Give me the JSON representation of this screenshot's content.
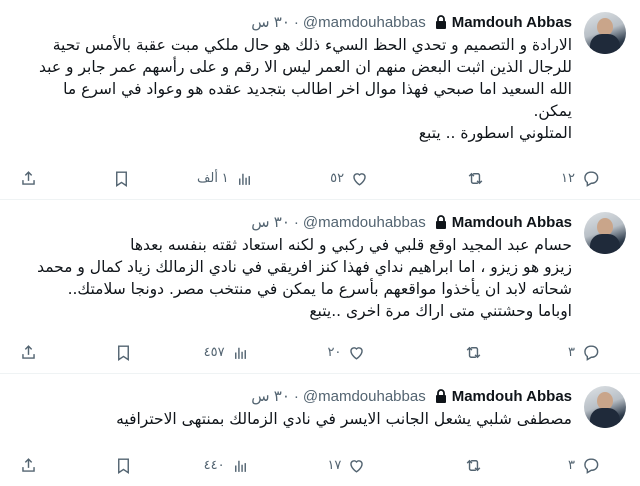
{
  "tweets": [
    {
      "author": "Mamdouh Abbas",
      "handle": "@mamdouhabbas",
      "time": "٣٠ س",
      "text": "الارادة و التصميم و تحدي الحظ السيء ذلك هو حال ملكي مبت عقبة بالأمس تحية للرجال الذين اثبت البعض منهم ان العمر ليس الا رقم و على رأسهم عمر جابر و عبد الله السعيد اما صبحي فهذا موال اخر اطالب بتجديد عقده هو وعواد في اسرع ما يمكن.\nالمتلوني اسطورة .. يتبع",
      "replies": "١٢",
      "retweets": "",
      "likes": "٥٢",
      "views": "١ ألف"
    },
    {
      "author": "Mamdouh Abbas",
      "handle": "@mamdouhabbas",
      "time": "٣٠ س",
      "text": "حسام عبد المجيد اوقع قلبي في ركبي و لكنه استعاد ثقته بنفسه بعدها\nزيزو هو زيزو ، اما ابراهيم نداي فهذا كنز افريقي  في نادي الزمالك زياد كمال و محمد شحاته لابد  ان يأخذوا مواقعهم بأسرع ما يمكن في منتخب مصر. دونجا سلامتك..\nاوباما وحشتني متى اراك مرة اخرى ..يتبع",
      "replies": "٣",
      "retweets": "",
      "likes": "٢٠",
      "views": "٤٥٧"
    },
    {
      "author": "Mamdouh Abbas",
      "handle": "@mamdouhabbas",
      "time": "٣٠ س",
      "text": "مصطفى شلبي يشعل الجانب الايسر في نادي الزمالك بمنتهى الاحترافيه",
      "replies": "٣",
      "retweets": "",
      "likes": "١٧",
      "views": "٤٤٠"
    }
  ],
  "icons": [
    "lock-icon",
    "reply-icon",
    "retweet-icon",
    "like-icon",
    "views-icon",
    "bookmark-icon",
    "share-icon"
  ]
}
